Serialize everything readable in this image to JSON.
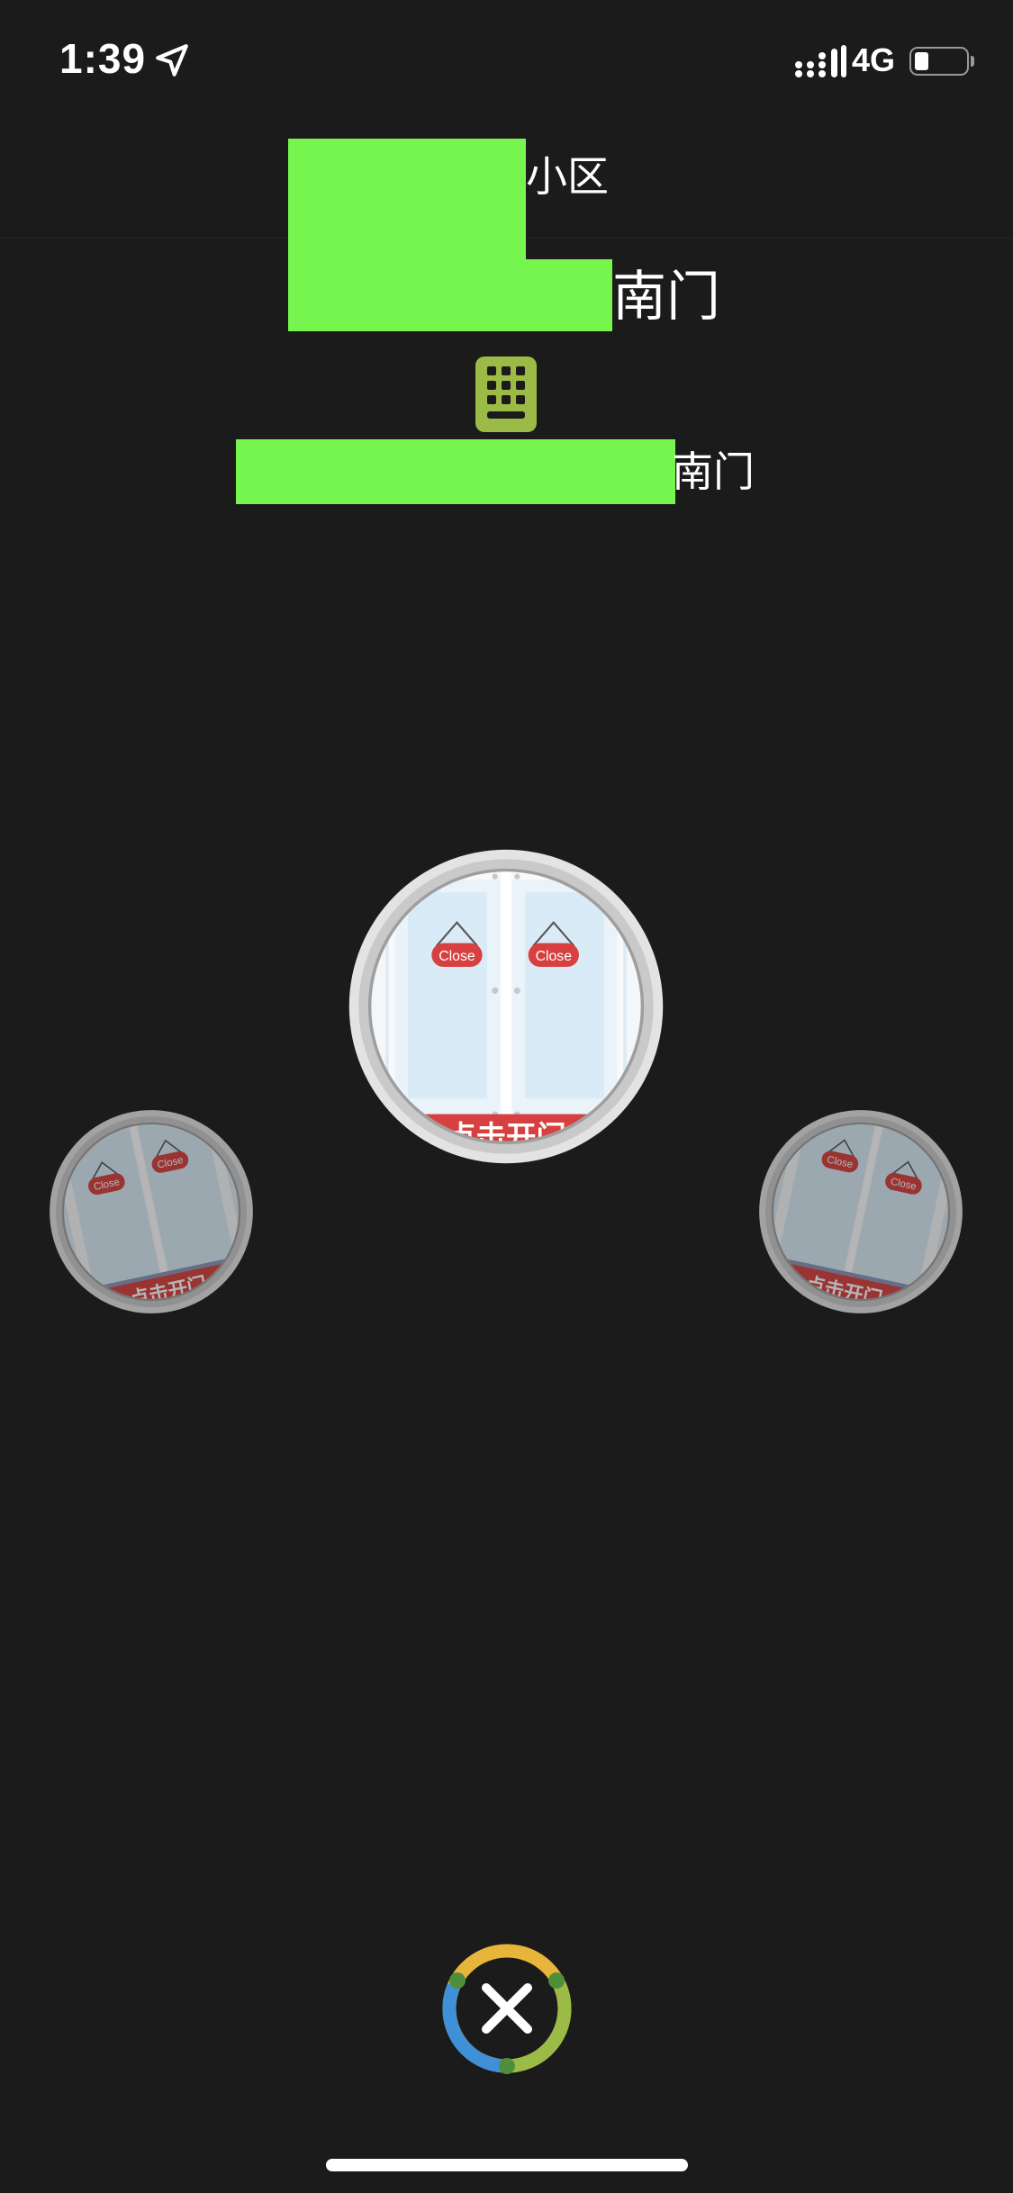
{
  "status_bar": {
    "time": "1:39",
    "network": "4G",
    "battery_level": 0.25,
    "location_icon": "location-arrow-icon",
    "signal_icon": "signal-bars-icon"
  },
  "header": {
    "community_suffix": "小区",
    "gate_suffix": "南门",
    "keypad_icon": "keypad-icon",
    "door_suffix": "南门"
  },
  "doors": {
    "open_label": "点击开门",
    "sign_label": "Close"
  },
  "footer": {
    "close_icon": "close-icon"
  },
  "colors": {
    "background": "#1b1b1b",
    "redaction": "#76f54e",
    "keypad": "#9bbb46",
    "banner_red": "#d7403f"
  }
}
